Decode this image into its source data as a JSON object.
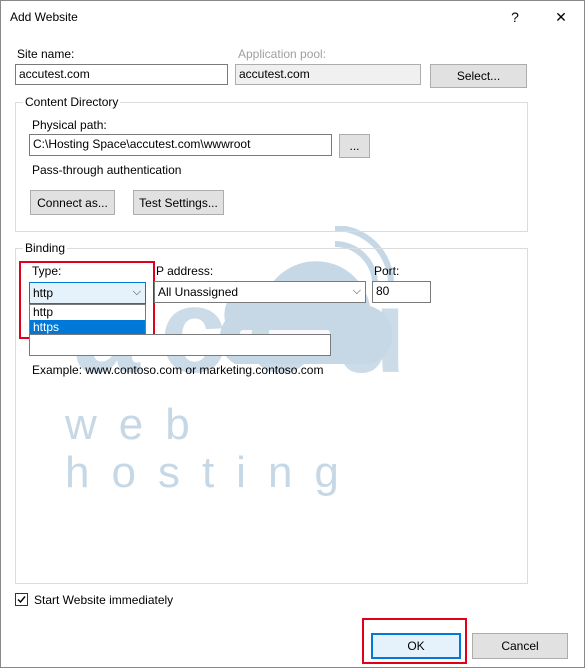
{
  "window": {
    "title": "Add Website",
    "help": "?",
    "close": "✕"
  },
  "site": {
    "name_label": "Site name:",
    "name_value": "accutest.com",
    "pool_label": "Application pool:",
    "pool_value": "accutest.com",
    "select_button": "Select..."
  },
  "content": {
    "group_label": "Content Directory",
    "path_label": "Physical path:",
    "path_value": "C:\\Hosting Space\\accutest.com\\wwwroot",
    "browse_button": "...",
    "passthrough_label": "Pass-through authentication",
    "connect_button": "Connect as...",
    "test_button": "Test Settings..."
  },
  "binding": {
    "group_label": "Binding",
    "type_label": "Type:",
    "type_value": "http",
    "type_options": [
      "http",
      "https"
    ],
    "ip_label": "P address:",
    "ip_value": "All Unassigned",
    "port_label": "Port:",
    "port_value": "80",
    "hostname_value": "",
    "example_text": "Example: www.contoso.com or marketing.contoso.com"
  },
  "start": {
    "checkbox_label": "Start Website immediately",
    "checked": true
  },
  "footer": {
    "ok_button": "OK",
    "cancel_button": "Cancel"
  },
  "watermark": {
    "text1": "accu",
    "text2": "web hosting"
  },
  "colors": {
    "highlight_red": "#e0001a",
    "selection_blue": "#0078d7",
    "watermark": "#c6d8e6"
  }
}
